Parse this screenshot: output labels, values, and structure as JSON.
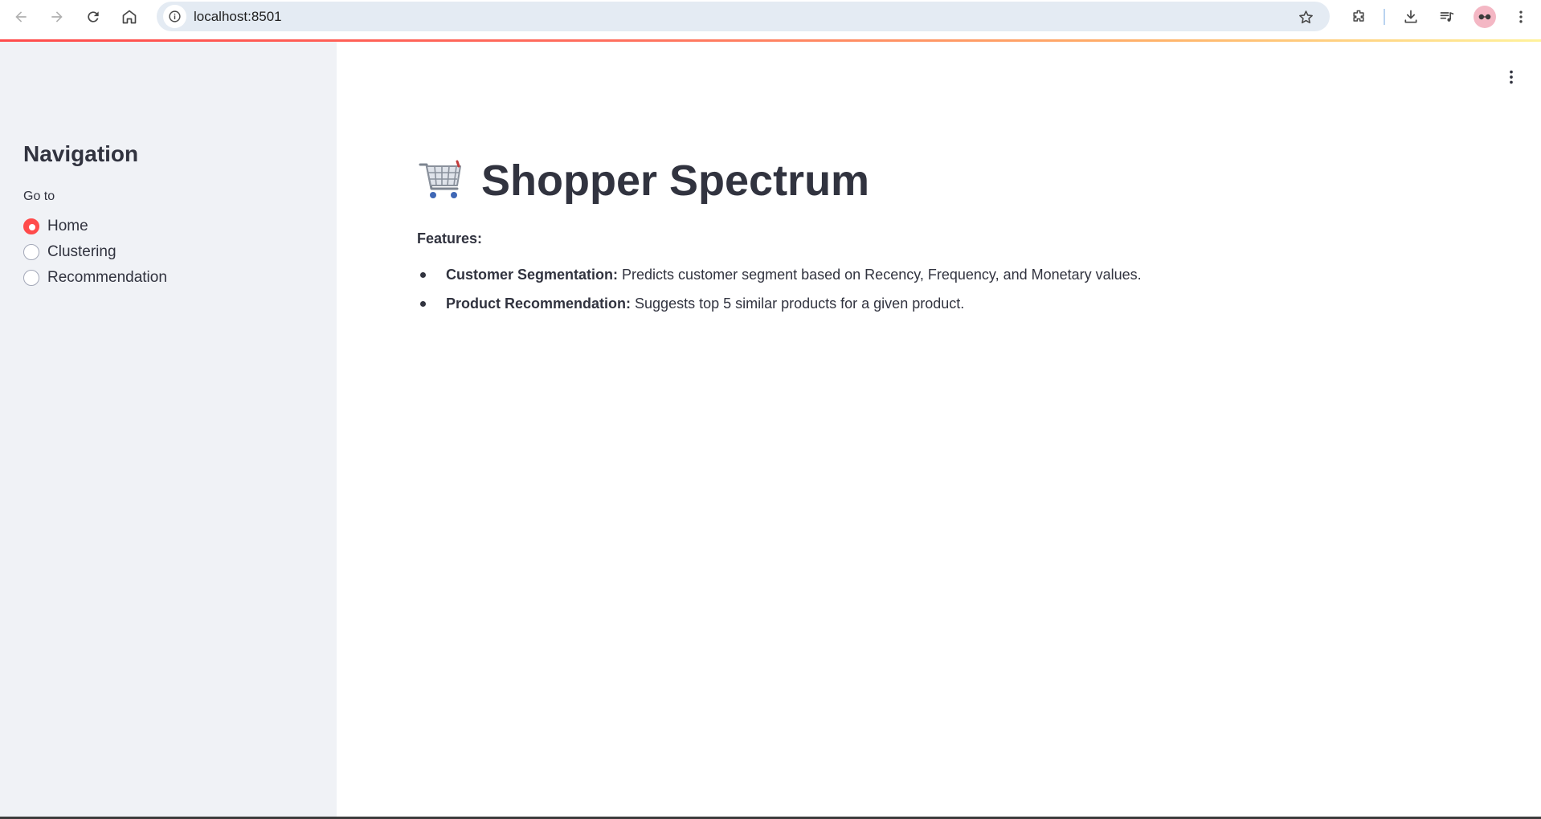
{
  "browser": {
    "url": "localhost:8501"
  },
  "sidebar": {
    "title": "Navigation",
    "radio_label": "Go to",
    "options": [
      {
        "label": "Home",
        "selected": true
      },
      {
        "label": "Clustering",
        "selected": false
      },
      {
        "label": "Recommendation",
        "selected": false
      }
    ]
  },
  "main": {
    "title": "Shopper Spectrum",
    "title_icon": "shopping-cart-icon",
    "features_label": "Features:",
    "features": [
      {
        "name": "Customer Segmentation:",
        "description": " Predicts customer segment based on Recency, Frequency, and Monetary values."
      },
      {
        "name": "Product Recommendation:",
        "description": " Suggests top 5 similar products for a given product."
      }
    ]
  },
  "colors": {
    "accent": "#ff4b4b",
    "sidebar_bg": "#f0f2f6",
    "text": "#31333f",
    "omnibox_bg": "#e4ebf3"
  }
}
